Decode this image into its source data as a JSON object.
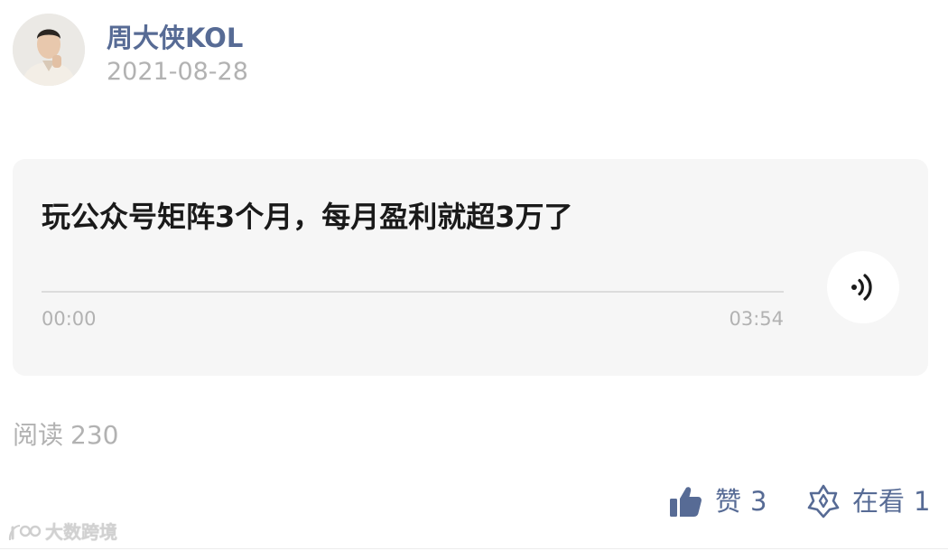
{
  "author": {
    "name": "周大侠KOL",
    "date": "2021-08-28"
  },
  "audio": {
    "title": "玩公众号矩阵3个月，每月盈利就超3万了",
    "current_time": "00:00",
    "total_time": "03:54",
    "progress": 0,
    "play_icon": "audio-wave-icon"
  },
  "stats": {
    "read_label": "阅读",
    "read_count": "230",
    "like_label": "赞",
    "like_count": "3",
    "like_icon": "thumbs-up-icon",
    "watch_label": "在看",
    "watch_count": "1",
    "watch_icon": "star-badge-icon"
  },
  "watermark": {
    "text": "大数跨境",
    "icon": "logo-mark-icon"
  },
  "colors": {
    "link_blue": "#576b95",
    "muted_gray": "#b2b2b2",
    "card_bg": "#f6f6f6",
    "title_text": "#1a1a1a"
  }
}
